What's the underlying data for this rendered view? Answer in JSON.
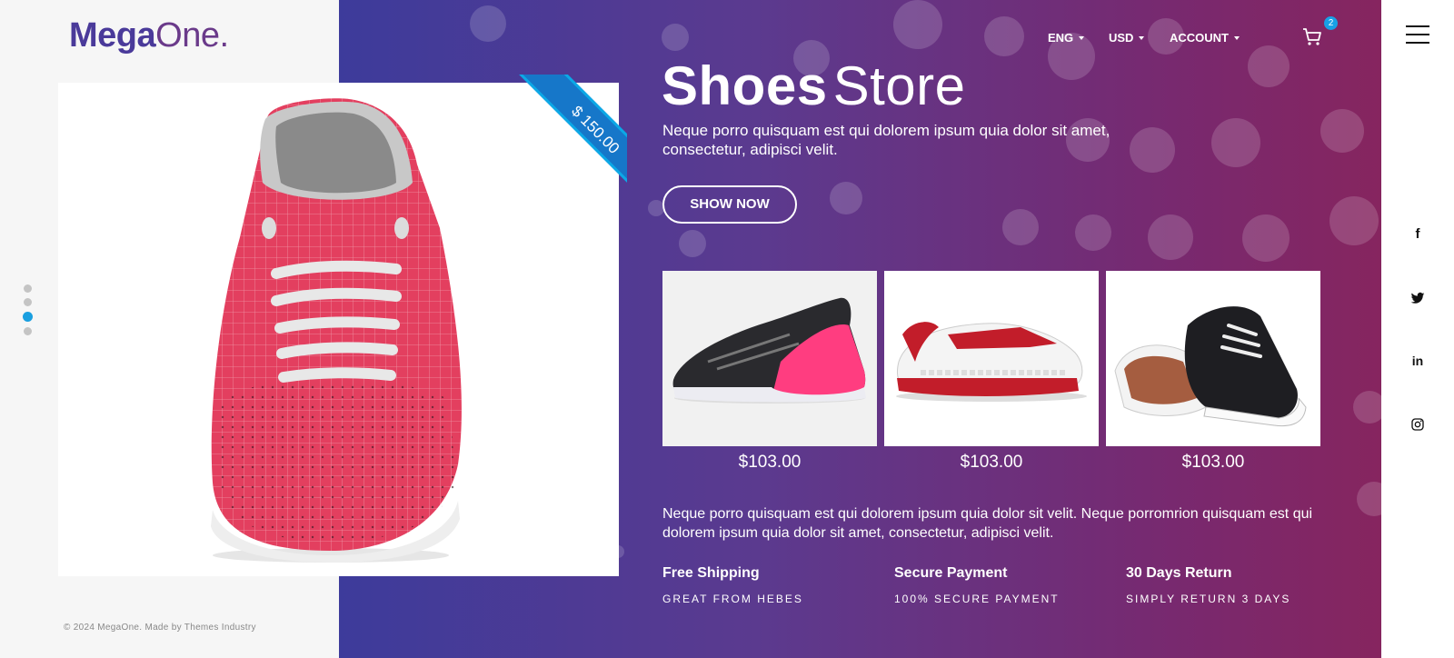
{
  "brand": {
    "name_bold": "Mega",
    "name_light": "One."
  },
  "nav": {
    "language": "ENG",
    "currency": "USD",
    "account": "ACCOUNT",
    "cart_count": "2"
  },
  "hero": {
    "title_bold": "Shoes",
    "title_light": "Store",
    "subtitle": "Neque porro quisquam est qui dolorem ipsum quia dolor sit amet, consectetur, adipisci velit.",
    "cta_label": "SHOW NOW",
    "featured_price": "$ 150.00"
  },
  "products": [
    {
      "price": "$103.00",
      "image": "pink-black-sneaker"
    },
    {
      "price": "$103.00",
      "image": "red-white-sneaker"
    },
    {
      "price": "$103.00",
      "image": "black-canvas-shoe"
    }
  ],
  "description": "Neque porro quisquam est qui dolorem ipsum quia dolor sit velit. Neque porromrion quisquam est qui dolorem ipsum quia dolor sit amet, consectetur, adipisci velit.",
  "features": [
    {
      "title": "Free Shipping",
      "subtitle": "GREAT FROM HEBES"
    },
    {
      "title": "Secure Payment",
      "subtitle": "100% SECURE PAYMENT"
    },
    {
      "title": "30 Days Return",
      "subtitle": "SIMPLY RETURN 3 DAYS"
    }
  ],
  "slider": {
    "total_slides": 4,
    "active_slide": 3
  },
  "footer": {
    "copyright": "© 2024 MegaOne. Made by Themes Industry"
  },
  "social": [
    "facebook-icon",
    "twitter-icon",
    "linkedin-icon",
    "instagram-icon"
  ],
  "colors": {
    "gradient_start": "#3d3b9b",
    "gradient_end": "#86255f",
    "accent": "#1a9fe0",
    "brand_purple": "#4a3a9a"
  }
}
